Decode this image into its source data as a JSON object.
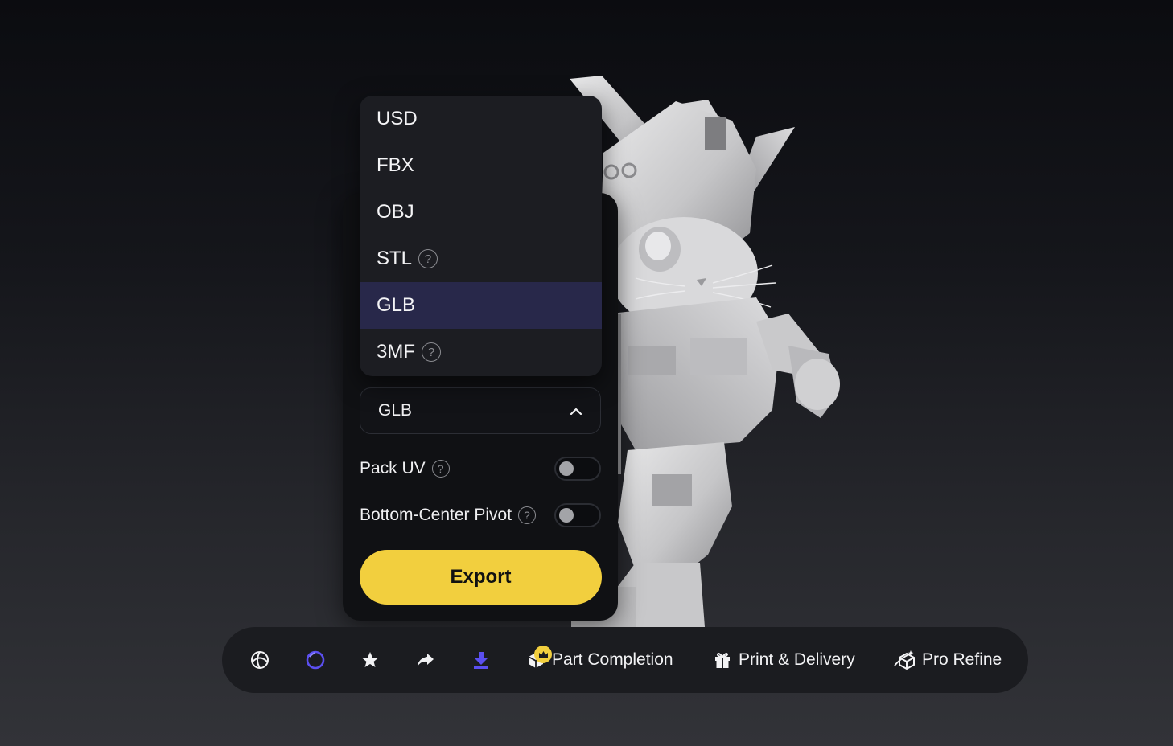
{
  "export_panel": {
    "format_menu": {
      "items": [
        {
          "label": "USD",
          "help": false,
          "selected": false
        },
        {
          "label": "FBX",
          "help": false,
          "selected": false
        },
        {
          "label": "OBJ",
          "help": false,
          "selected": false
        },
        {
          "label": "STL",
          "help": true,
          "selected": false
        },
        {
          "label": "GLB",
          "help": false,
          "selected": true
        },
        {
          "label": "3MF",
          "help": true,
          "selected": false
        }
      ]
    },
    "format_select": {
      "value": "GLB",
      "icon": "chevron-up-icon"
    },
    "options": [
      {
        "label": "Pack UV",
        "enabled": false
      },
      {
        "label": "Bottom-Center Pivot",
        "enabled": false
      }
    ],
    "export_label": "Export",
    "help_glyph": "?"
  },
  "toolbar": {
    "icon_buttons": [
      {
        "icon": "sphere-icon",
        "active": false
      },
      {
        "icon": "circle-ring-icon",
        "active": true
      },
      {
        "icon": "star-icon",
        "active": false
      },
      {
        "icon": "share-arrow-icon",
        "active": false
      },
      {
        "icon": "download-icon",
        "active": true
      }
    ],
    "labeled_buttons": [
      {
        "label": "Part Completion",
        "icon": "cube-parts-icon",
        "badge": "crown-icon"
      },
      {
        "label": "Print & Delivery",
        "icon": "gift-icon"
      },
      {
        "label": "Pro Refine",
        "icon": "refine-cube-icon"
      }
    ]
  },
  "colors": {
    "accent": "#5b4ff0",
    "export_button": "#f2cf3e",
    "menu_selected": "#28284a",
    "panel_bg": "#101114"
  }
}
